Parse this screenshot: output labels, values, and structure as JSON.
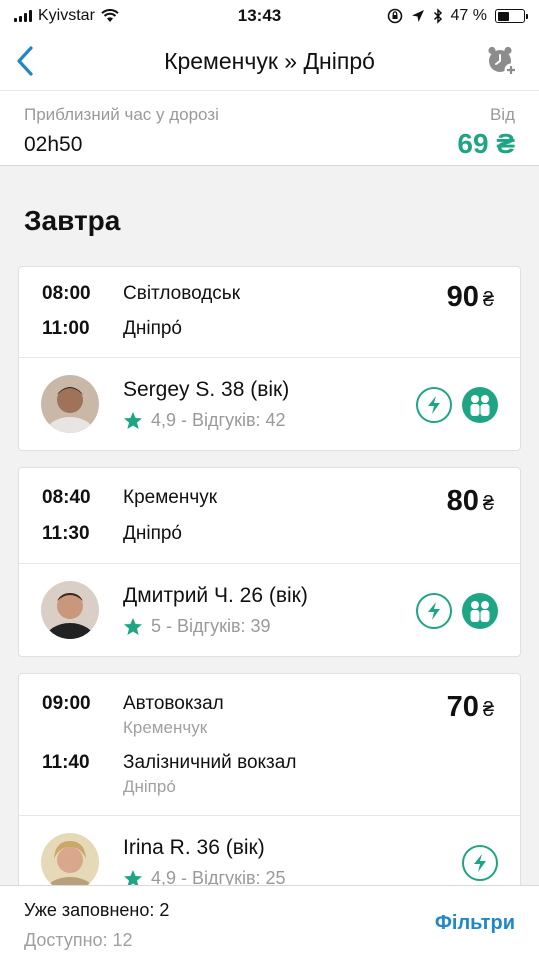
{
  "status_bar": {
    "carrier": "Kyivstar",
    "time": "13:43",
    "battery": "47 %",
    "battery_level": 0.47
  },
  "header": {
    "title": "Кременчук » Дніпро́"
  },
  "summary": {
    "duration_label": "Приблизний час у дорозі",
    "duration": "02h50",
    "from_label": "Від",
    "from_price": "69 ₴"
  },
  "day_label": "Завтра",
  "currency": "₴",
  "trips": [
    {
      "depart_time": "08:00",
      "depart_place": "Світловодськ",
      "depart_sub": "",
      "arrive_time": "11:00",
      "arrive_place": "Дніпро́",
      "arrive_sub": "",
      "price": "90",
      "driver": {
        "name": "Sergey S. 38 (вік)",
        "rating": "4,9 - Відгуків: 42"
      },
      "badges": [
        "lightning-icon",
        "passengers-icon"
      ]
    },
    {
      "depart_time": "08:40",
      "depart_place": "Кременчук",
      "depart_sub": "",
      "arrive_time": "11:30",
      "arrive_place": "Дніпро́",
      "arrive_sub": "",
      "price": "80",
      "driver": {
        "name": "Дмитрий Ч. 26 (вік)",
        "rating": "5 - Відгуків: 39"
      },
      "badges": [
        "lightning-icon",
        "passengers-icon"
      ]
    },
    {
      "depart_time": "09:00",
      "depart_place": "Автовокзал",
      "depart_sub": "Кременчук",
      "arrive_time": "11:40",
      "arrive_place": "Залізничний вокзал",
      "arrive_sub": "Дніпро́",
      "price": "70",
      "driver": {
        "name": "Irina R. 36 (вік)",
        "rating": "4,9 - Відгуків: 25"
      },
      "badges": [
        "lightning-icon"
      ]
    }
  ],
  "bottom": {
    "filled": "Уже заповнено: 2",
    "available": "Доступно: 12",
    "filters_label": "Фільтри"
  },
  "colors": {
    "accent": "#1ea584",
    "link": "#1e88c8"
  }
}
